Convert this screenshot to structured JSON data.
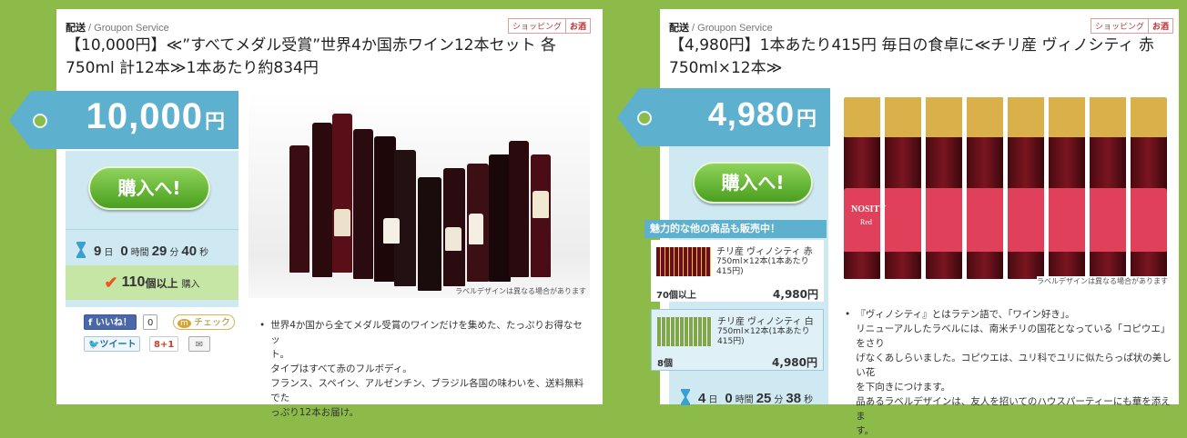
{
  "left": {
    "category": {
      "main": "配送",
      "sep": " / ",
      "sub": "Groupon Service"
    },
    "tags": [
      "ショッピング",
      "お酒"
    ],
    "title_line1": "【10,000円】≪”すべてメダル受賞”世界4か国赤ワイン12本セット 各",
    "title_line2": "750ml 計12本≫1本あたり約834円",
    "price": "10,000",
    "yen": "円",
    "buy_label": "購入へ!",
    "timer": {
      "days": "9",
      "days_unit": "日",
      "hours": "0",
      "hours_unit": "時間",
      "minutes": "29",
      "minutes_unit": "分",
      "seconds": "40",
      "seconds_unit": "秒"
    },
    "sold": {
      "count": "110",
      "unit": "個以上",
      "suffix": "購入"
    },
    "social": {
      "like": "いいね！",
      "like_count": "0",
      "check": "チェック",
      "tweet": "ツイート",
      "gplus": "8+1"
    },
    "label_note": "ラベルデザインは異なる場合があります",
    "desc_lines": [
      "世界4か国から全てメダル受賞のワインだけを集めた、たっぷりお得なセッ",
      "ト。",
      "タイプはすべて赤のフルボディ。",
      "フランス、スペイン、アルゼンチン、ブラジル各国の味わいを、送料無料でた",
      "っぷり12本お届け。"
    ]
  },
  "right": {
    "category": {
      "main": "配送",
      "sep": " / ",
      "sub": "Groupon Service"
    },
    "tags": [
      "ショッピング",
      "お酒"
    ],
    "title_line1": "【4,980円】1本あたり415円 毎日の食卓に≪チリ産 ヴィノシティ 赤",
    "title_line2": "750ml×12本≫",
    "price": "4,980",
    "yen": "円",
    "buy_label": "購入へ!",
    "other_header": "魅力的な他の商品も販売中！",
    "other_items": [
      {
        "name1": "チリ産 ヴィノシティ 赤",
        "name2": "750ml×12本(1本あたり",
        "name3": "415円)",
        "qty": "70個以上",
        "price": "4,980円"
      },
      {
        "name1": "チリ産 ヴィノシティ 白",
        "name2": "750ml×12本(1本あたり",
        "name3": "415円)",
        "qty": "8個",
        "price": "4,980円"
      }
    ],
    "timer": {
      "days": "4",
      "days_unit": "日",
      "hours": "0",
      "hours_unit": "時間",
      "minutes": "25",
      "minutes_unit": "分",
      "seconds": "38",
      "seconds_unit": "秒"
    },
    "label_note": "ラベルデザインは異なる場合があります",
    "bottle_label": "NOSITY",
    "bottle_sub": "Red",
    "desc_lines": [
      "『ヴィノシティ』とはラテン語で、「ワイン好き」。",
      "リニューアルしたラベルには、南米チリの国花となっている「コピウエ」をさり",
      "げなくあしらいました。コピウエは、ユリ科でユリに似たらっぱ状の美しい花",
      "を下向きにつけます。",
      "品あるラベルデザインは、友人を招いてのハウスパーティーにも華を添えま",
      "す。"
    ]
  },
  "colors": {
    "bg": "#8dbb4a",
    "banner": "#5eb0cf",
    "side": "#cfe9f2",
    "button": "#4a9f1f",
    "sold": "#c6e6a6"
  }
}
